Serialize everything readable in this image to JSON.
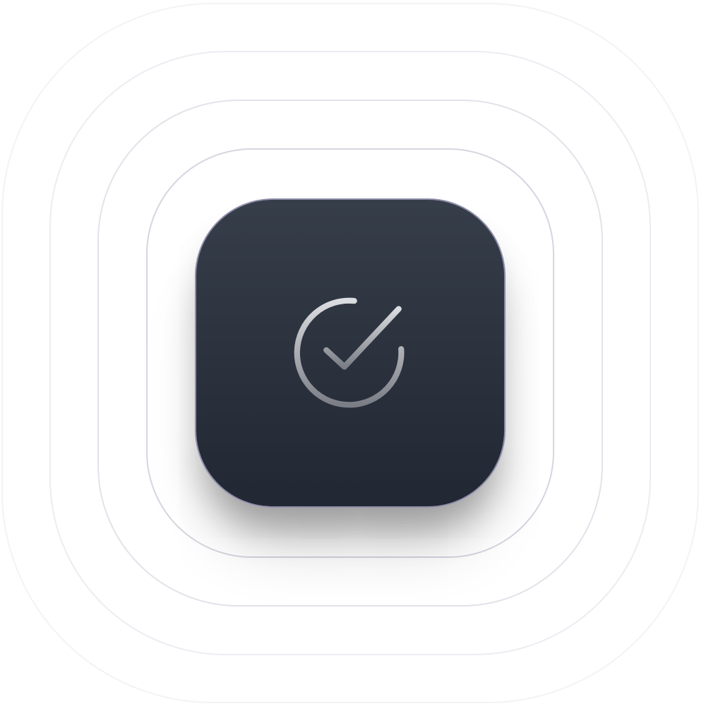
{
  "badge": {
    "icon": "check-circle-icon",
    "colors": {
      "background": "#ffffff",
      "tile_top": "#363e4a",
      "tile_bottom": "#212733",
      "tile_border": "#8f8da8",
      "icon_top": "#dcdde0",
      "icon_bottom": "#7b7e86"
    }
  }
}
